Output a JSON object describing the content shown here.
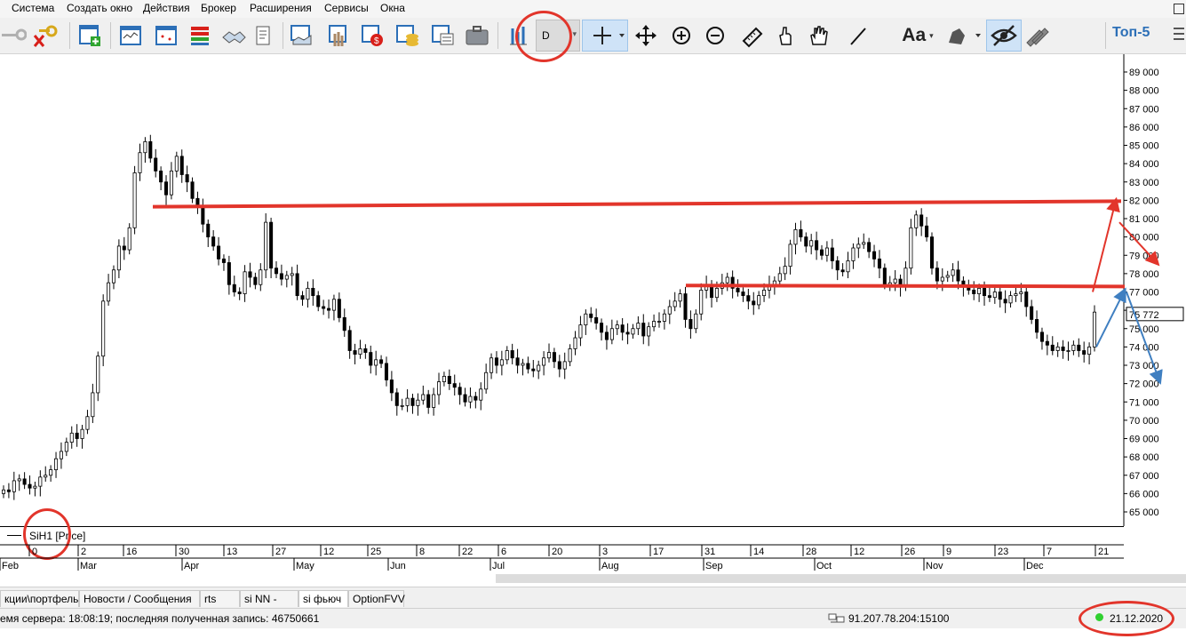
{
  "menu": [
    "Система",
    "Создать окно",
    "Действия",
    "Брокер",
    "Расширения",
    "Сервисы",
    "Окна"
  ],
  "toolbar": {
    "interval": "D",
    "font_label": "Aa",
    "top5_label": "Топ-5"
  },
  "icons": [
    "key-icon",
    "disconnect-icon",
    "new-window-icon",
    "quotes-table-icon",
    "chart-icon",
    "depth-icon",
    "trades-icon",
    "orders-icon",
    "new-order-icon",
    "stop-order-icon",
    "portfolio-icon",
    "limits-icon",
    "accounts-icon",
    "briefcase-icon",
    "bar-chart-icon",
    "crosshair-icon",
    "move-icon",
    "zoom-in-icon",
    "zoom-out-icon",
    "ruler-icon",
    "hand-point-icon",
    "hand-drag-icon",
    "line-tool-icon",
    "text-font-icon",
    "alert-bell-icon",
    "hide-eye-icon",
    "pen-tools-icon",
    "list-icon"
  ],
  "chart": {
    "series_label": "SiH1 [Price]",
    "last_price_label": "75 772",
    "y_ticks": [
      "89 000",
      "88 000",
      "87 000",
      "86 000",
      "85 000",
      "84 000",
      "83 000",
      "82 000",
      "81 000",
      "80 000",
      "79 000",
      "78 000",
      "77 000",
      "76 000",
      "75 000",
      "74 000",
      "73 000",
      "72 000",
      "71 000",
      "70 000",
      "69 000",
      "68 000",
      "67 000",
      "66 000",
      "65 000"
    ],
    "day_ticks": [
      "0",
      "2",
      "16",
      "30",
      "13",
      "27",
      "12",
      "25",
      "8",
      "22",
      "6",
      "20",
      "3",
      "17",
      "31",
      "14",
      "28",
      "12",
      "26",
      "9",
      "23",
      "7",
      "21"
    ],
    "month_ticks": [
      "Feb",
      "Mar",
      "Apr",
      "May",
      "Jun",
      "Jul",
      "Aug",
      "Sep",
      "Oct",
      "Nov",
      "Dec"
    ]
  },
  "chart_data": {
    "type": "candlestick",
    "instrument": "SiH1",
    "interval": "D",
    "ylim": [
      64500,
      89700
    ],
    "y_tick_step": 1000,
    "closes": [
      66200,
      66100,
      66700,
      66800,
      66500,
      66300,
      66400,
      66900,
      67000,
      67300,
      67900,
      68300,
      68800,
      69300,
      69000,
      69500,
      70200,
      71500,
      73500,
      76500,
      77500,
      78200,
      79500,
      79300,
      80500,
      83500,
      84600,
      85200,
      84300,
      83600,
      83000,
      82300,
      83600,
      84400,
      83400,
      83000,
      82100,
      81600,
      80700,
      80000,
      79500,
      78800,
      78600,
      77400,
      77000,
      76900,
      78100,
      77800,
      77400,
      78200,
      80800,
      78300,
      78000,
      77700,
      77900,
      78000,
      76800,
      76600,
      77200,
      76800,
      76200,
      76100,
      76000,
      76600,
      75600,
      74900,
      73800,
      73600,
      73900,
      73700,
      73000,
      73300,
      73100,
      72200,
      71500,
      70800,
      70800,
      71200,
      70800,
      71100,
      71400,
      70700,
      71400,
      72100,
      72400,
      72000,
      71800,
      71400,
      71000,
      71300,
      71100,
      71700,
      72600,
      73400,
      73000,
      73300,
      73800,
      73400,
      73000,
      73100,
      72800,
      72700,
      73000,
      73400,
      73700,
      73200,
      72800,
      73200,
      73900,
      74500,
      75200,
      75800,
      75600,
      75300,
      74800,
      74400,
      75000,
      75200,
      74800,
      74700,
      75000,
      75300,
      74600,
      75100,
      75400,
      75400,
      75800,
      76200,
      76500,
      76900,
      75500,
      75000,
      75800,
      77100,
      77400,
      76700,
      77200,
      77500,
      77800,
      77200,
      77000,
      76800,
      76500,
      76300,
      76800,
      77100,
      77400,
      77600,
      78000,
      78400,
      79600,
      80400,
      80000,
      79500,
      79800,
      79300,
      79000,
      79400,
      78700,
      78200,
      78100,
      78700,
      79400,
      79600,
      79700,
      79200,
      78800,
      78300,
      77400,
      77500,
      77700,
      77300,
      78300,
      80500,
      81200,
      80600,
      80000,
      78300,
      77600,
      77800,
      77900,
      78200,
      77600,
      77300,
      77100,
      76900,
      77200,
      76800,
      76700,
      77000,
      76600,
      76400,
      76800,
      76900,
      77000,
      76200,
      75500,
      74800,
      74300,
      74100,
      73800,
      74000,
      73800,
      73800,
      74100,
      73800,
      73600,
      74000,
      75900
    ]
  },
  "tabs": [
    "кции\\портфель",
    "Новости / Сообщения",
    "rts",
    "si NN -Call",
    "si фьюч",
    "OptionFVV"
  ],
  "active_tab": "si фьюч",
  "status": {
    "server_time_text": "емя сервера: 18:08:19; последняя полученная запись: 46750661",
    "connection": "91.207.78.204:15100",
    "date": "21.12.2020"
  },
  "colors": {
    "annotation_red": "#e2352b",
    "annotation_blue": "#3f7fc1",
    "candle": "#000000",
    "toolbar_bg": "#f0f0f0",
    "active_tool_bg": "#cfe3f7",
    "status_dot": "#2fd02f"
  }
}
